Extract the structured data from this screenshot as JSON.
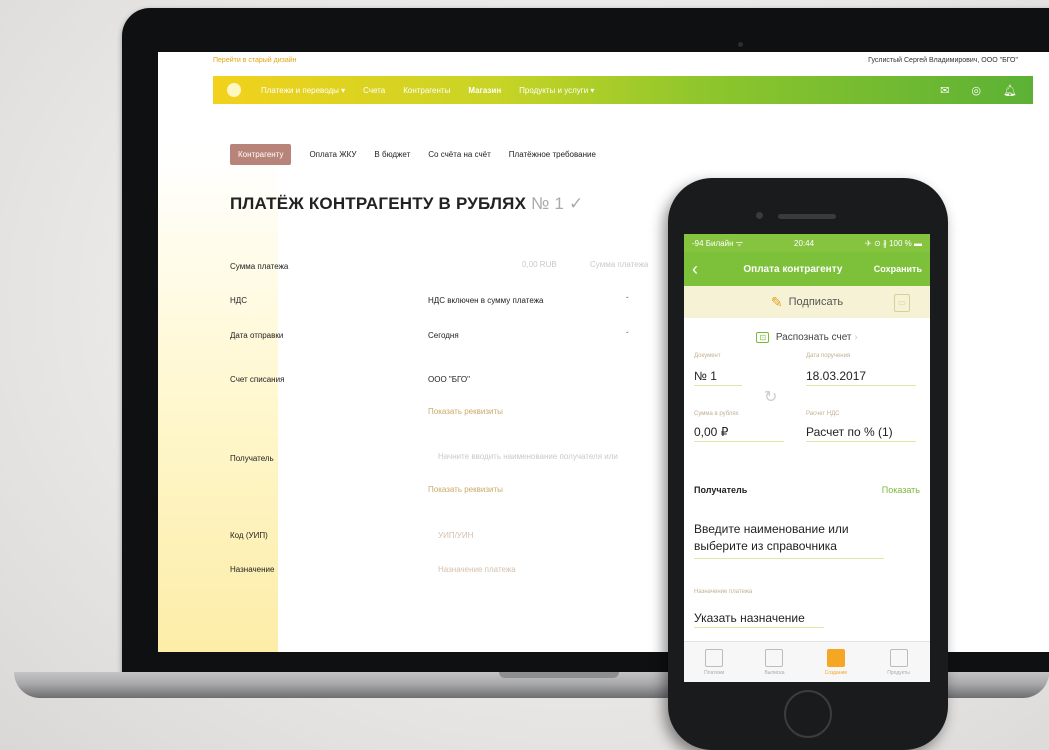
{
  "desktop": {
    "old_design_link": "Перейти в старый дизайн",
    "user_name": "Гуслистый Сергей Владимирович, ООО \"БГО\"",
    "nav": [
      {
        "label": "Платежи и переводы ▾",
        "active": false
      },
      {
        "label": "Счета",
        "active": false
      },
      {
        "label": "Контрагенты",
        "active": false
      },
      {
        "label": "Магазин",
        "active": true
      },
      {
        "label": "Продукты и услуги ▾",
        "active": false
      }
    ],
    "nav_icons": [
      "mail-icon",
      "chat-icon",
      "bell-icon"
    ],
    "tabs": [
      "Контрагенту",
      "Оплата ЖКУ",
      "В бюджет",
      "Со счёта на счёт",
      "Платёжное требование"
    ],
    "title": "ПЛАТЁЖ КОНТРАГЕНТУ В РУБЛЯХ",
    "doc_number": "№ 1 ✓",
    "amount_placeholder": "0,00 RUB",
    "amount_words_placeholder": "Сумма платежа",
    "rows": {
      "amount_label": "Сумма платежа",
      "vat_label": "НДС",
      "vat_value": "НДС включен в сумму платежа",
      "date_label": "Дата отправки",
      "date_value": "Сегодня",
      "account_label": "Счет списания",
      "account_value": "ООО \"БГО\"",
      "show_details_1": "Показать реквизиты",
      "recipient_label": "Получатель",
      "recipient_placeholder": "Начните вводить наименование получателя или",
      "show_details_2": "Показать реквизиты",
      "code_label": "Код (УИП)",
      "code_placeholder": "УИП/УИН",
      "purpose_label": "Назначение",
      "purpose_placeholder": "Назначение платежа"
    }
  },
  "phone": {
    "status_carrier": "-94 Билайн ᯤ",
    "status_time": "20:44",
    "status_battery": "✈ ⊙ ∦ 100 % ▬",
    "header_title": "Оплата контрагенту",
    "save_label": "Сохранить",
    "sign_label": "Подписать",
    "recognize_label": "Распознать счет",
    "doc_label": "Документ",
    "doc_value": "№ 1",
    "date_label": "Дата поручения",
    "date_value": "18.03.2017",
    "sum_label": "Сумма в рублях",
    "sum_value": "0,00 ₽",
    "vat_label": "Расчет НДС",
    "vat_value": "Расчет по % (1)",
    "recipient_label": "Получатель",
    "recipient_show": "Показать",
    "recipient_placeholder": "Введите наименование или выберите из справочника",
    "purpose_label": "Назначение платежа",
    "purpose_placeholder": "Указать назначение",
    "tabbar": [
      {
        "label": "Платежи",
        "icon": "card-icon",
        "active": false
      },
      {
        "label": "Выписка",
        "icon": "statement-icon",
        "active": false
      },
      {
        "label": "Создание",
        "icon": "create-icon",
        "active": true
      },
      {
        "label": "Продукты",
        "icon": "products-icon",
        "active": false
      }
    ]
  }
}
